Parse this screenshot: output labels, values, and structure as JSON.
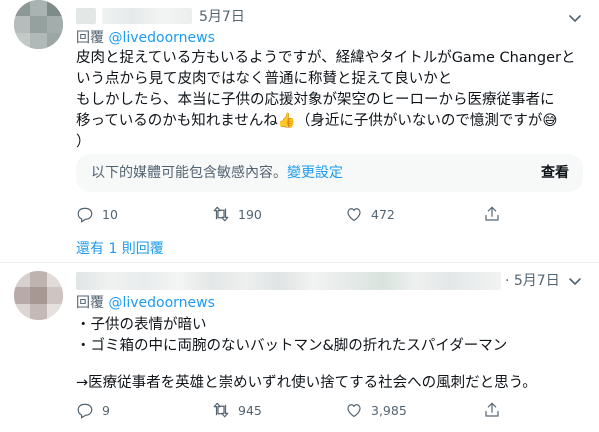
{
  "tweets": [
    {
      "date": "5月7日",
      "reply_label": "回覆",
      "reply_handle": "@livedoornews",
      "lines": [
        "皮肉と捉えている方もいるようですが、経緯やタイトルがGame Changerと",
        "いう点から見て皮肉ではなく普通に称賛と捉えて良いかと",
        "もしかしたら、本当に子供の応援対象が架空のヒーローから医療従事者に",
        "移っているのかも知れませんね👍（身近に子供がいないので憶測ですが😅",
        "）"
      ],
      "sensitive": {
        "message": "以下的媒體可能包含敏感內容。",
        "link": "變更設定",
        "view_label": "查看"
      },
      "actions": {
        "replies": "10",
        "retweets": "190",
        "likes": "472"
      },
      "more_replies": "還有 1 則回覆"
    },
    {
      "date": "· 5月7日",
      "reply_label": "回覆",
      "reply_handle": "@livedoornews",
      "lines": [
        "・子供の表情が暗い",
        "・ゴミ箱の中に両腕のないバットマン&脚の折れたスパイダーマン",
        "",
        "→医療従事者を英雄と崇めいずれ使い捨てする社会への風刺だと思う。"
      ],
      "actions": {
        "replies": "9",
        "retweets": "945",
        "likes": "3,985"
      }
    }
  ],
  "colors": {
    "accent": "#1d9bf0",
    "secondary_text": "#536471",
    "divider": "#eff3f4"
  },
  "icons": [
    "chevron-down-icon",
    "reply-icon",
    "retweet-icon",
    "like-icon",
    "share-icon"
  ]
}
